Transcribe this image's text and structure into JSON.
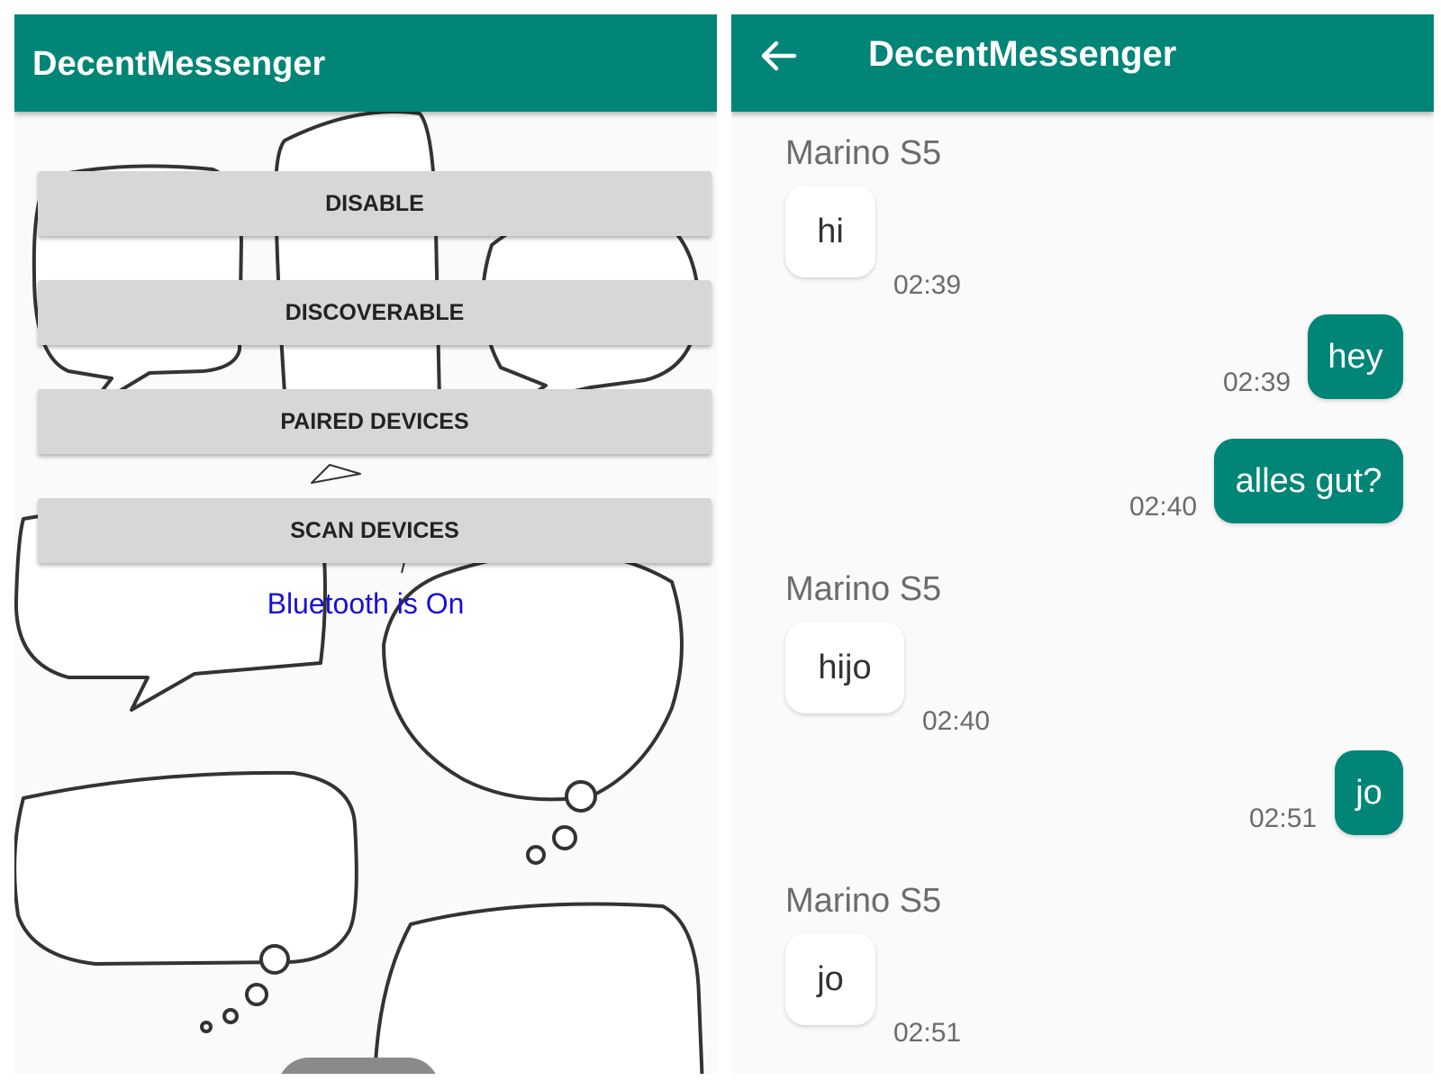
{
  "colors": {
    "app_bar": "#008577",
    "outgoing_bubble": "#008577",
    "incoming_bubble": "#ffffff",
    "status_text": "#1a0fd8",
    "button_bg": "#d6d7d7"
  },
  "home": {
    "title": "DecentMessenger",
    "buttons": {
      "disable": "DISABLE",
      "discoverable": "DISCOVERABLE",
      "paired": "PAIRED DEVICES",
      "scan": "SCAN DEVICES"
    },
    "status": "Bluetooth is On"
  },
  "chat": {
    "title": "DecentMessenger",
    "back_icon": "arrow-back-icon",
    "messages": [
      {
        "direction": "in",
        "sender": "Marino S5",
        "text": "hi",
        "time": "02:39"
      },
      {
        "direction": "out",
        "text": "hey",
        "time": "02:39"
      },
      {
        "direction": "out",
        "text": "alles gut?",
        "time": "02:40"
      },
      {
        "direction": "in",
        "sender": "Marino S5",
        "text": "hijo",
        "time": "02:40"
      },
      {
        "direction": "out",
        "text": "jo",
        "time": "02:51"
      },
      {
        "direction": "in",
        "sender": "Marino S5",
        "text": "jo",
        "time": "02:51"
      }
    ]
  }
}
